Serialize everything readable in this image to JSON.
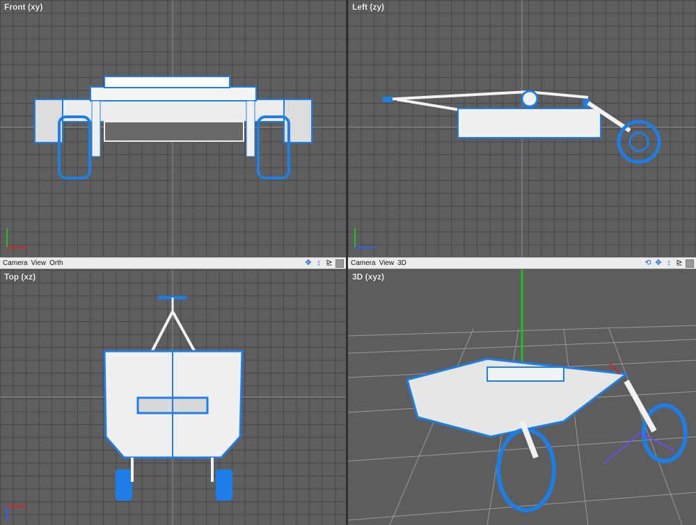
{
  "viewports": {
    "front": {
      "label": "Front (xy)",
      "axis_up": "Y",
      "axis_right": "X"
    },
    "left": {
      "label": "Left (zy)",
      "axis_up": "Y",
      "axis_right": "Z"
    },
    "top": {
      "label": "Top (xz)",
      "axis_up": "Z",
      "axis_right": "X"
    },
    "perspective": {
      "label": "3D (xyz)"
    }
  },
  "bars": {
    "left": {
      "menu": [
        "Camera",
        "View",
        "Orth"
      ]
    },
    "right": {
      "menu": [
        "Camera",
        "View",
        "3D"
      ]
    }
  },
  "icons": {
    "orbit": "orbit-icon",
    "pan": "pan-icon",
    "zoom": "zoom-icon",
    "render": "render-icon",
    "maximize": "maximize-icon"
  },
  "colors": {
    "wire_blue": "#1e7ee8",
    "mesh_white": "#f2f2f2",
    "grid_bg": "#5e5e5e",
    "axis_red": "#e02020",
    "axis_green": "#20c020",
    "axis_blue": "#2a5cff"
  }
}
